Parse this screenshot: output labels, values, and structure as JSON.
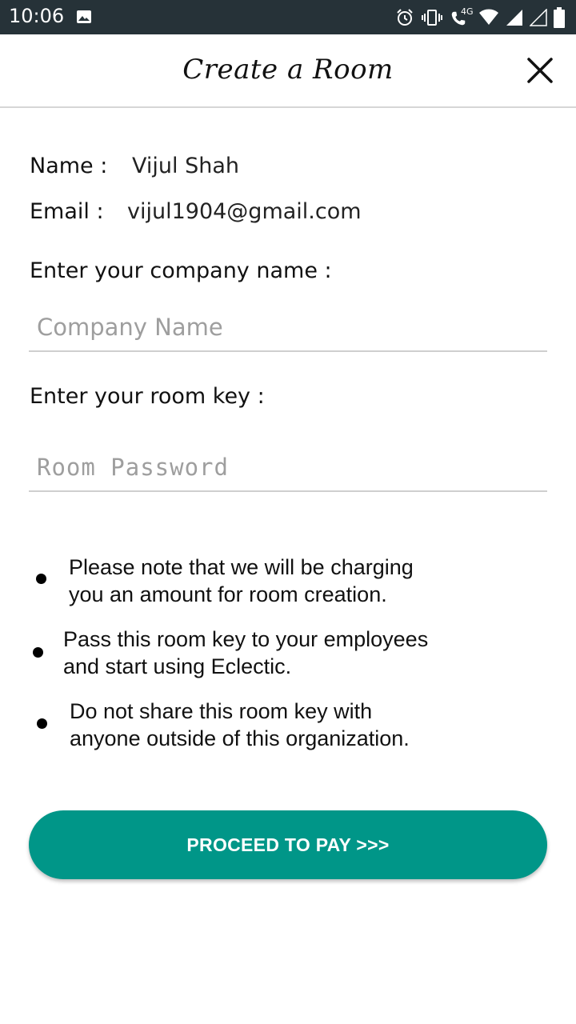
{
  "status_bar": {
    "time": "10:06",
    "icons": [
      "image-icon",
      "alarm-icon",
      "vibrate-icon",
      "volte-call-icon",
      "wifi-icon",
      "signal-icon",
      "signal-empty-icon",
      "battery-icon"
    ],
    "network_label": "4G"
  },
  "header": {
    "title": "Create a Room",
    "close_icon": "close-icon"
  },
  "profile": {
    "name_label": "Name :",
    "name_value": "Vijul Shah",
    "email_label": "Email :",
    "email_value": "vijul1904@gmail.com"
  },
  "form": {
    "company_label": "Enter your company name :",
    "company_placeholder": "Company Name",
    "company_value": "",
    "room_key_label": "Enter your room key :",
    "room_key_placeholder": "Room Password",
    "room_key_value": ""
  },
  "notes": [
    {
      "line1": "Please note that we will be charging",
      "line2": "you an amount for room creation."
    },
    {
      "line1": "Pass this room key to your employees",
      "line2": "and start using Eclectic."
    },
    {
      "line1": "Do not share this room key with",
      "line2": "anyone outside of this organization."
    }
  ],
  "action": {
    "pay_label": "PROCEED TO PAY >>>"
  },
  "colors": {
    "status_bar": "#263238",
    "accent": "#009688",
    "divider": "#d6d6d6"
  }
}
